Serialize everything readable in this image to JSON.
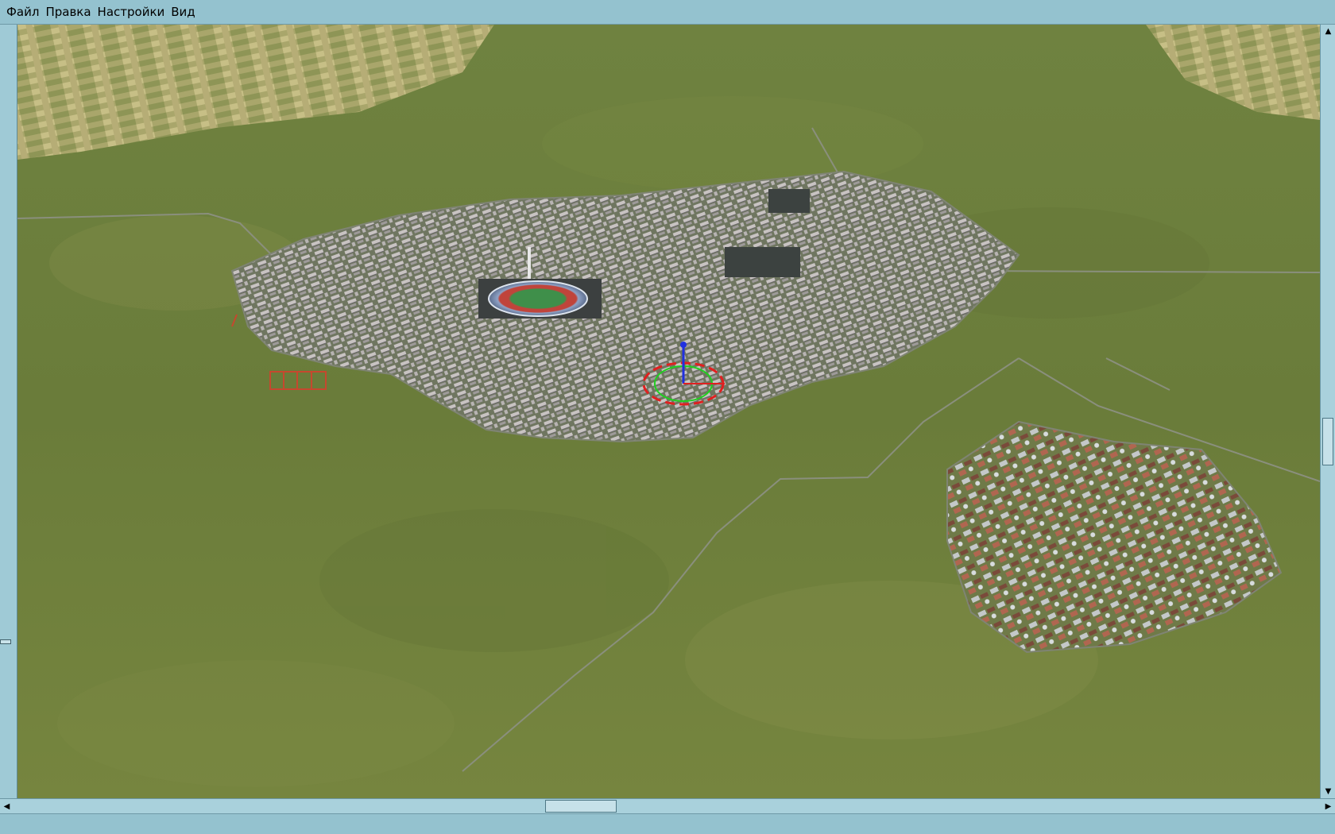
{
  "menu": {
    "items": [
      {
        "label": "Файл"
      },
      {
        "label": "Правка"
      },
      {
        "label": "Настройки"
      },
      {
        "label": "Вид"
      }
    ]
  },
  "icons": {
    "scroll_up": "arrow-up-icon",
    "scroll_down": "arrow-down-icon",
    "scroll_left": "arrow-left-icon",
    "scroll_right": "arrow-right-icon",
    "transform_gizmo": "transform-gizmo-icon"
  },
  "colors": {
    "chrome": "#94c2cf",
    "terrain": "#6b7f3c",
    "road": "#8a8f7d",
    "gizmo_red": "#e02020",
    "gizmo_green": "#20d020",
    "gizmo_blue": "#2030e0"
  },
  "status": {
    "text": ""
  }
}
